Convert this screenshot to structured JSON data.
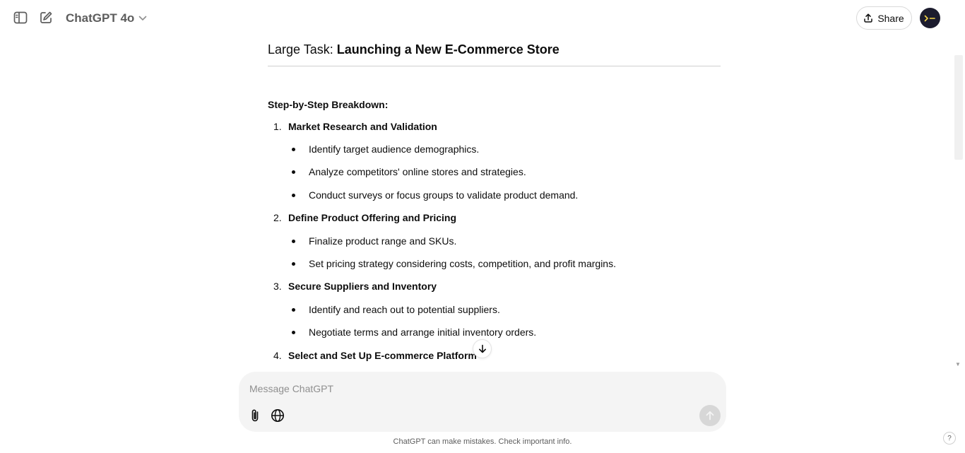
{
  "header": {
    "model_name": "ChatGPT 4o",
    "share_label": "Share",
    "avatar_text": ">–"
  },
  "heading": {
    "prefix": "Large Task: ",
    "title": "Launching a New E-Commerce Store"
  },
  "breakdown_label": "Step-by-Step Breakdown:",
  "steps": [
    {
      "number": "1.",
      "title": "Market Research and Validation",
      "bullets": [
        "Identify target audience demographics.",
        "Analyze competitors' online stores and strategies.",
        "Conduct surveys or focus groups to validate product demand."
      ]
    },
    {
      "number": "2.",
      "title": "Define Product Offering and Pricing",
      "bullets": [
        "Finalize product range and SKUs.",
        "Set pricing strategy considering costs, competition, and profit margins."
      ]
    },
    {
      "number": "3.",
      "title": "Secure Suppliers and Inventory",
      "bullets": [
        "Identify and reach out to potential suppliers.",
        "Negotiate terms and arrange initial inventory orders."
      ]
    },
    {
      "number": "4.",
      "title": "Select and Set Up E-commerce Platform",
      "bullets": []
    }
  ],
  "composer": {
    "placeholder": "Message ChatGPT"
  },
  "footer": {
    "disclaimer": "ChatGPT can make mistakes. Check important info.",
    "help_label": "?"
  },
  "icons": {
    "sidebar_toggle": "sidebar-icon",
    "new_chat": "compose-icon",
    "model_chevron": "chevron-down-icon",
    "share": "upload-icon",
    "scroll_down": "arrow-down-icon",
    "attach": "paperclip-icon",
    "globe": "globe-icon",
    "send": "arrow-up-icon"
  },
  "colors": {
    "accent_dark": "#1c1c2e",
    "composer_bg": "#f4f4f4",
    "send_disabled": "#d7d7d7"
  }
}
